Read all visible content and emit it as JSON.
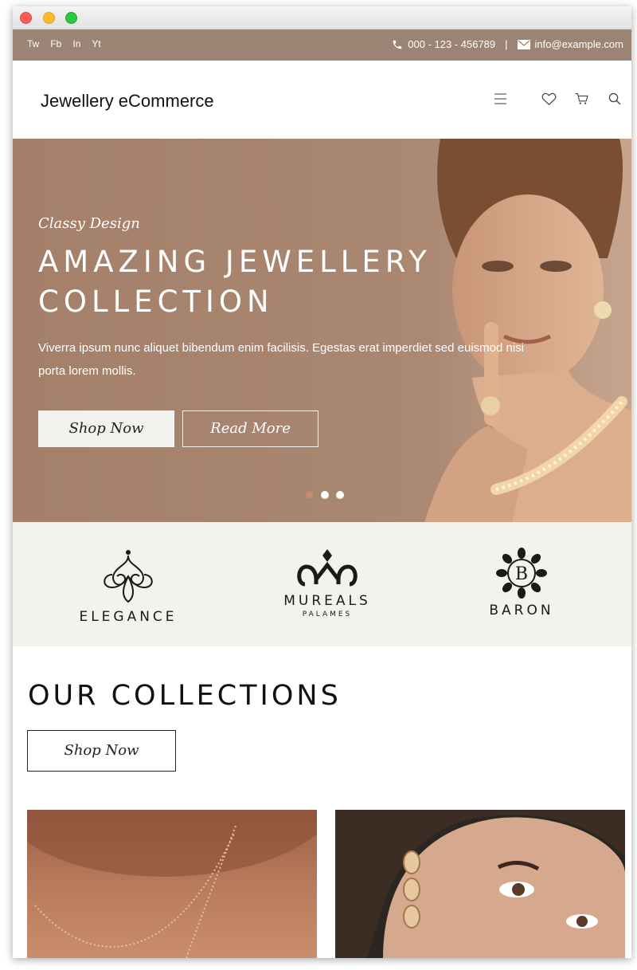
{
  "topbar": {
    "social": [
      "Tw",
      "Fb",
      "In",
      "Yt"
    ],
    "phone": "000 - 123 - 456789",
    "separator": "|",
    "email": "info@example.com"
  },
  "header": {
    "brand": "Jewellery eCommerce",
    "icons": [
      "menu-icon",
      "heart-icon",
      "cart-icon",
      "search-icon"
    ]
  },
  "hero": {
    "subtitle": "Classy Design",
    "title": "AMAZING JEWELLERY COLLECTION",
    "text": "Viverra ipsum nunc aliquet bibendum enim facilisis. Egestas erat imperdiet sed euismod nisi porta lorem mollis.",
    "primary_button": "Shop Now",
    "secondary_button": "Read More",
    "slides": 3,
    "active_slide": 1
  },
  "brands": [
    {
      "name": "ELEGANCE",
      "sub": ""
    },
    {
      "name": "MUREALS",
      "sub": "PALAMES"
    },
    {
      "name": "BARON",
      "sub": ""
    }
  ],
  "collections": {
    "title": "OUR COLLECTIONS",
    "button": "Shop Now"
  },
  "colors": {
    "topbar": "#9c8474",
    "hero": "#a98671",
    "brands_bg": "#f4f2ed",
    "active_dot": "#c48b6d"
  }
}
